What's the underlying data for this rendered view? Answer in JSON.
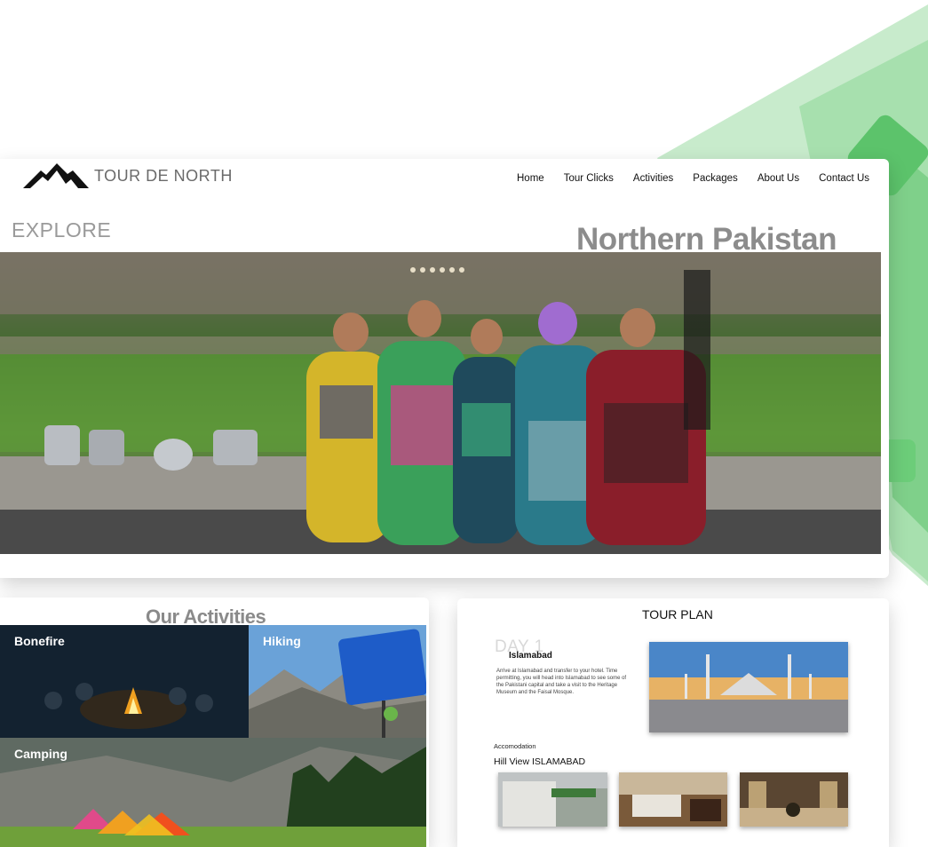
{
  "brand": {
    "name": "TOUR DE NORTH",
    "logo_icon": "mountain-icon"
  },
  "nav": {
    "items": [
      "Home",
      "Tour Clicks",
      "Activities",
      "Packages",
      "About Us",
      "Contact Us"
    ]
  },
  "hero": {
    "left_title": "EXPLORE",
    "right_title": "Northern Pakistan",
    "slides": 6
  },
  "activities": {
    "title": "Our Activities",
    "tiles": [
      "Bonefire",
      "Hiking",
      "Camping"
    ]
  },
  "tour_plan": {
    "title": "TOUR PLAN",
    "day": "DAY 1",
    "city": "Islamabad",
    "description": "Arrive at Islamabad and transfer to your hotel. Time permitting, you will head into Islamabad to see some of the Pakistani capital and take a visit to the Heritage Museum and the Faisal Mosque.",
    "accommodation_label": "Accomodation",
    "hotel_name": "Hill View ISLAMABAD"
  },
  "colors": {
    "accent_green": "#6fd17a",
    "text_grey": "#8c8c8c"
  }
}
